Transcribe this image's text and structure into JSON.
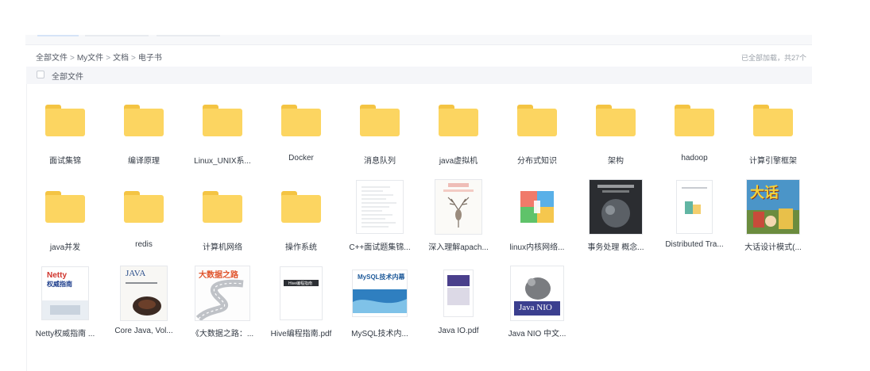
{
  "breadcrumb": {
    "items": [
      "全部文件",
      "My文件",
      "文档",
      "电子书"
    ],
    "separator": ">"
  },
  "status": {
    "loaded_text": "已全部加载，共27个"
  },
  "list_header": {
    "select_all_label": "全部文件"
  },
  "files": [
    {
      "name": "面试集锦",
      "type": "folder"
    },
    {
      "name": "编译原理",
      "type": "folder"
    },
    {
      "name": "Linux_UNIX系...",
      "type": "folder"
    },
    {
      "name": "Docker",
      "type": "folder"
    },
    {
      "name": "消息队列",
      "type": "folder"
    },
    {
      "name": "java虚拟机",
      "type": "folder"
    },
    {
      "name": "分布式知识",
      "type": "folder"
    },
    {
      "name": "架构",
      "type": "folder"
    },
    {
      "name": "hadoop",
      "type": "folder"
    },
    {
      "name": "计算引擎框架",
      "type": "folder"
    },
    {
      "name": "java并发",
      "type": "folder"
    },
    {
      "name": "redis",
      "type": "folder"
    },
    {
      "name": "计算机网络",
      "type": "folder"
    },
    {
      "name": "操作系统",
      "type": "folder"
    },
    {
      "name": "C++面试题集锦...",
      "type": "pdf",
      "cover": "doc-page"
    },
    {
      "name": "深入理解apach...",
      "type": "pdf",
      "cover": "apache-deer",
      "cover_text": "深入理解 Apache Dubbo与实战"
    },
    {
      "name": "linux内核网络...",
      "type": "archive",
      "cover": "archive-icon"
    },
    {
      "name": "事务处理 概念...",
      "type": "pdf",
      "cover": "dark-book",
      "cover_text": "事务处理 概念与技术"
    },
    {
      "name": "Distributed Tra...",
      "type": "pdf",
      "cover": "white-paper"
    },
    {
      "name": "大话设计模式(...",
      "type": "pdf",
      "cover": "dahua",
      "cover_text": "大话"
    },
    {
      "name": "Netty权威指南 ...",
      "type": "pdf",
      "cover": "netty",
      "cover_text": "Netty权威指南"
    },
    {
      "name": "Core Java, Vol...",
      "type": "pdf",
      "cover": "core-java",
      "cover_text": "JAVA"
    },
    {
      "name": "《大数据之路：...",
      "type": "pdf",
      "cover": "bigdata-road",
      "cover_text": "大数据之路"
    },
    {
      "name": "Hive编程指南.pdf",
      "type": "pdf",
      "cover": "hive",
      "cover_text": "Hive编程指南"
    },
    {
      "name": "MySQL技术内...",
      "type": "pdf",
      "cover": "mysql",
      "cover_text": "MySQL技术内幕"
    },
    {
      "name": "Java IO.pdf",
      "type": "pdf",
      "cover": "java-io"
    },
    {
      "name": "Java NIO 中文...",
      "type": "pdf",
      "cover": "java-nio",
      "cover_text": "Java NIO"
    }
  ]
}
